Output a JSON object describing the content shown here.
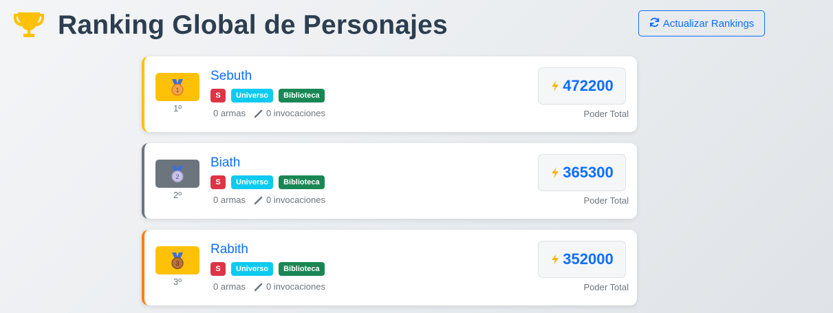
{
  "header": {
    "title": "Ranking Global de Personajes",
    "refresh_label": "Actualizar Rankings",
    "trophy_color": "#ffc107"
  },
  "colors": {
    "accent": "#0d6efd",
    "gold": "#ffc107",
    "silver": "#6c757d",
    "bronze": "#fd7e14",
    "badge_rank": "#dc3545",
    "badge_universe": "#0dcaf0",
    "badge_library": "#198754"
  },
  "rankings": [
    {
      "position": "1º",
      "medal_number": "1",
      "name": "Sebuth",
      "badges": [
        "S",
        "Universo",
        "Biblioteca"
      ],
      "weapons": "0 armas",
      "invocations": "0 invocaciones",
      "power": "472200",
      "power_label": "Poder Total"
    },
    {
      "position": "2º",
      "medal_number": "2",
      "name": "Biath",
      "badges": [
        "S",
        "Universo",
        "Biblioteca"
      ],
      "weapons": "0 armas",
      "invocations": "0 invocaciones",
      "power": "365300",
      "power_label": "Poder Total"
    },
    {
      "position": "3º",
      "medal_number": "3",
      "name": "Rabith",
      "badges": [
        "S",
        "Universo",
        "Biblioteca"
      ],
      "weapons": "0 armas",
      "invocations": "0 invocaciones",
      "power": "352000",
      "power_label": "Poder Total"
    }
  ]
}
